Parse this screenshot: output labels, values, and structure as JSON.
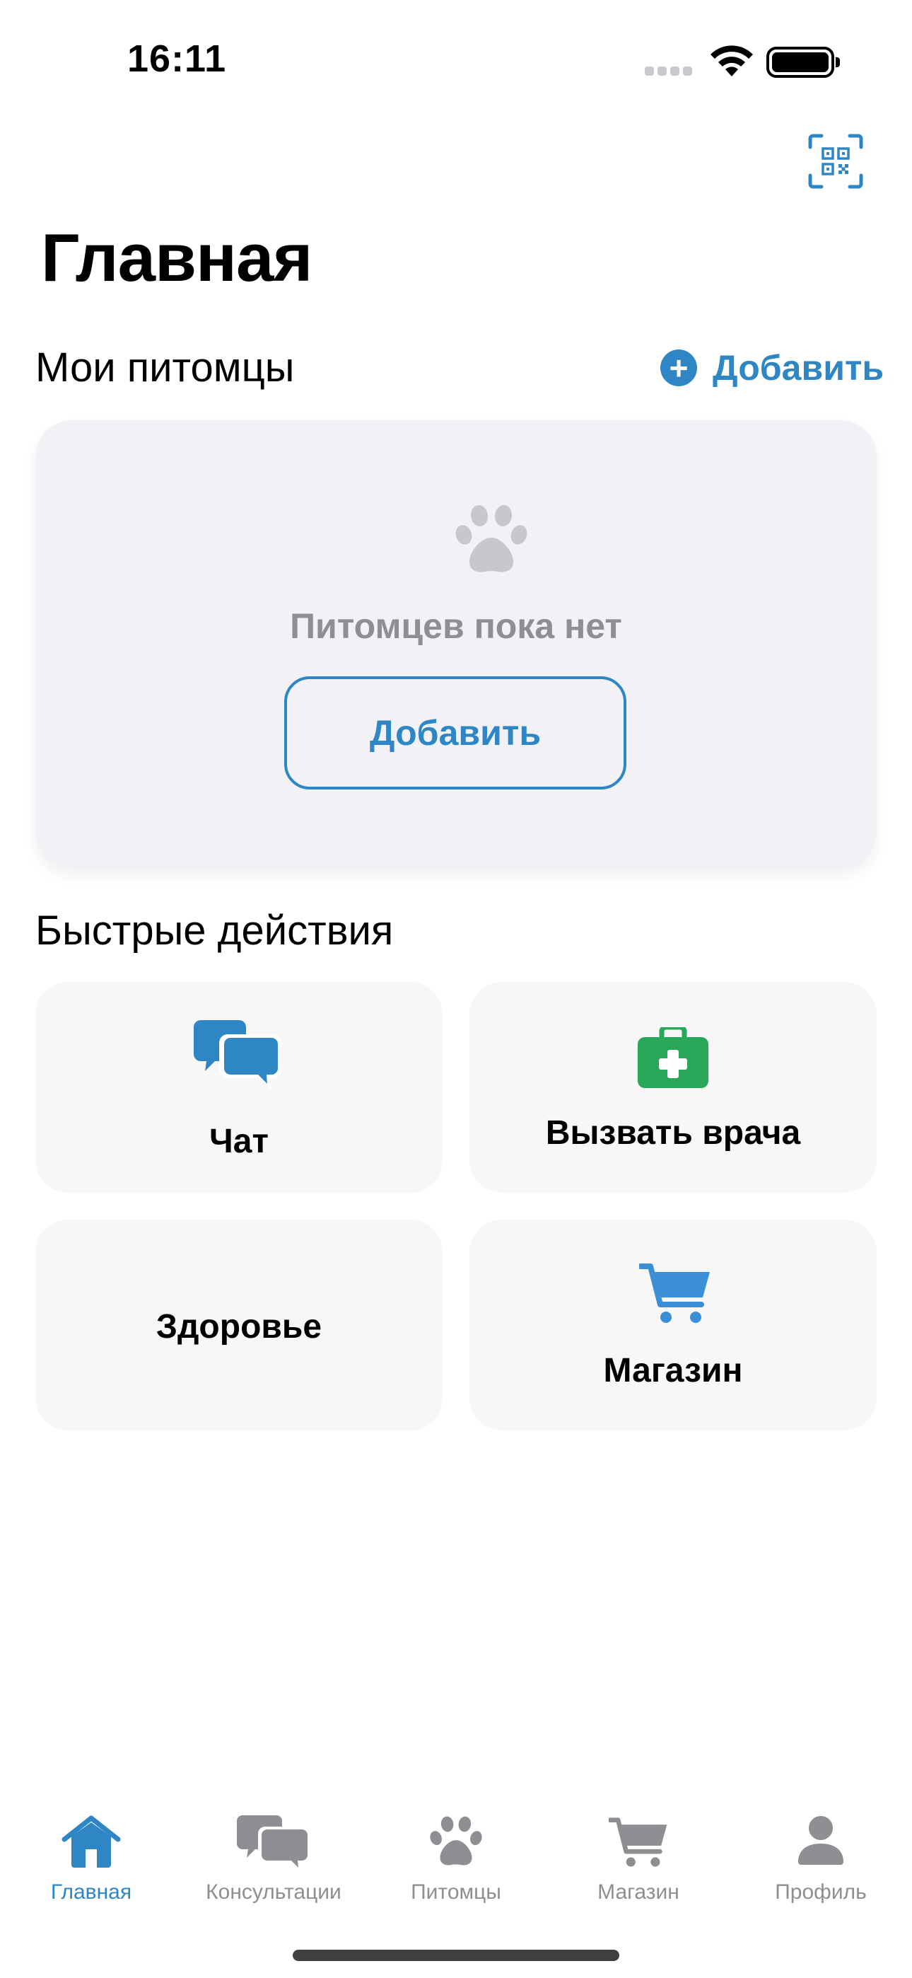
{
  "status_bar": {
    "time": "16:11"
  },
  "header": {
    "title": "Главная",
    "qr_icon": "qr-code-scan-icon"
  },
  "pets_section": {
    "title": "Мои питомцы",
    "add_link_label": "Добавить",
    "empty_text": "Питомцев пока нет",
    "add_button_label": "Добавить"
  },
  "quick_actions": {
    "title": "Быстрые действия",
    "items": [
      {
        "label": "Чат",
        "icon": "chat-bubbles-icon"
      },
      {
        "label": "Вызвать врача",
        "icon": "medkit-icon"
      },
      {
        "label": "Здоровье",
        "icon": ""
      },
      {
        "label": "Магазин",
        "icon": "shopping-cart-icon"
      }
    ]
  },
  "tab_bar": {
    "items": [
      {
        "label": "Главная",
        "icon": "house-icon",
        "active": true
      },
      {
        "label": "Консультации",
        "icon": "chat-bubbles-icon",
        "active": false
      },
      {
        "label": "Питомцы",
        "icon": "paw-icon",
        "active": false
      },
      {
        "label": "Магазин",
        "icon": "shopping-cart-icon",
        "active": false
      },
      {
        "label": "Профиль",
        "icon": "person-icon",
        "active": false
      }
    ]
  },
  "colors": {
    "accent": "#2f86c4",
    "medkit_green": "#2aa85a",
    "chat_blue": "#2f86c4",
    "cart_blue": "#3a8fd6",
    "muted": "#8e8e93",
    "card_bg": "#f2f2f6"
  }
}
